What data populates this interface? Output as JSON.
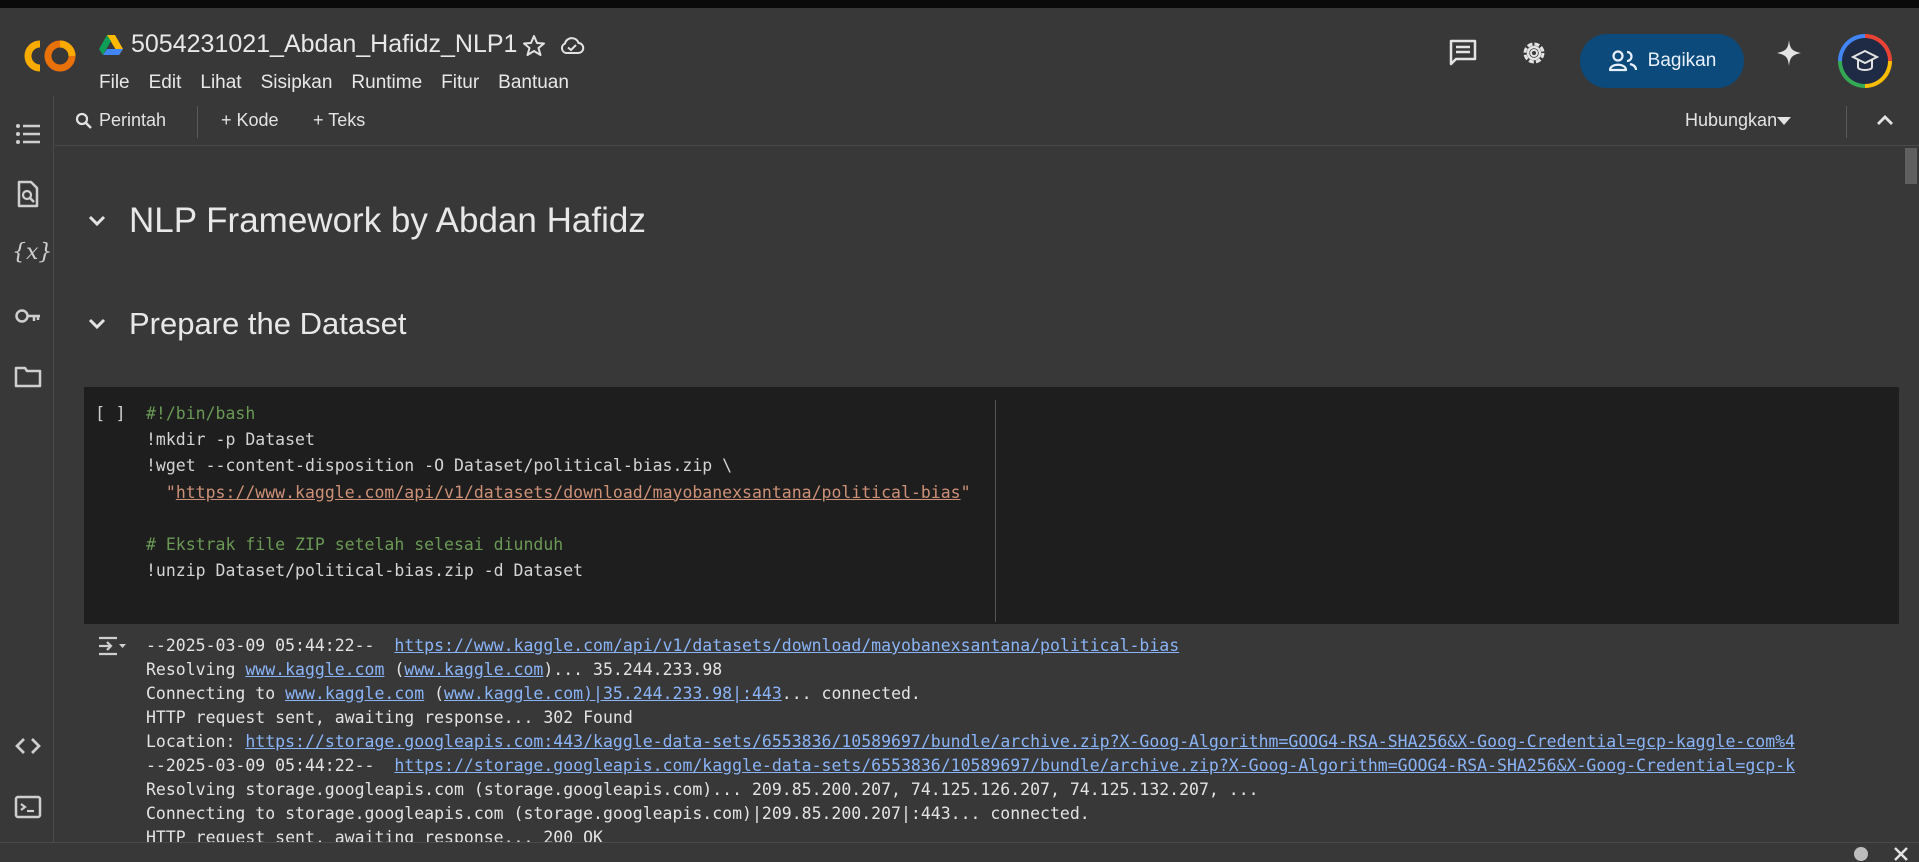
{
  "app": {
    "title": "5054231021_Abdan_Hafidz_NLP1",
    "menu": [
      "File",
      "Edit",
      "Lihat",
      "Sisipkan",
      "Runtime",
      "Fitur",
      "Bantuan"
    ],
    "share_label": "Bagikan"
  },
  "toolbar": {
    "command_label": "Perintah",
    "add_code_label": "+ Kode",
    "add_text_label": "+ Teks",
    "connect_label": "Hubungkan"
  },
  "notebook": {
    "heading1": "NLP Framework by Abdan Hafidz",
    "heading2": "Prepare the Dataset",
    "cell_brackets": "[ ]",
    "code": {
      "line1": "#!/bin/bash",
      "line2": "!mkdir -p Dataset",
      "line3": "!wget --content-disposition -O Dataset/political-bias.zip \\",
      "line4_q1": "  \"",
      "line4_url": "https://www.kaggle.com/api/v1/datasets/download/mayobanexsantana/political-bias",
      "line4_q2": "\"",
      "line6": "# Ekstrak file ZIP setelah selesai diunduh",
      "line7": "!unzip Dataset/political-bias.zip -d Dataset"
    },
    "output": {
      "l1_prefix": "--2025-03-09 05:44:22--  ",
      "l1_link": "https://www.kaggle.com/api/v1/datasets/download/mayobanexsantana/political-bias",
      "l2_a": "Resolving ",
      "l2_link1": "www.kaggle.com",
      "l2_b": " (",
      "l2_link2": "www.kaggle.com",
      "l2_c": ")... 35.244.233.98",
      "l3_a": "Connecting to ",
      "l3_link1": "www.kaggle.com",
      "l3_b": " (",
      "l3_link2": "www.kaggle.com)|35.244.233.98|:443",
      "l3_c": "... connected.",
      "l4": "HTTP request sent, awaiting response... 302 Found",
      "l5_a": "Location: ",
      "l5_link": "https://storage.googleapis.com:443/kaggle-data-sets/6553836/10589697/bundle/archive.zip?X-Goog-Algorithm=GOOG4-RSA-SHA256&X-Goog-Credential=gcp-kaggle-com%4",
      "l6_prefix": "--2025-03-09 05:44:22--  ",
      "l6_link": "https://storage.googleapis.com/kaggle-data-sets/6553836/10589697/bundle/archive.zip?X-Goog-Algorithm=GOOG4-RSA-SHA256&X-Goog-Credential=gcp-k",
      "l7": "Resolving storage.googleapis.com (storage.googleapis.com)... 209.85.200.207, 74.125.126.207, 74.125.132.207, ...",
      "l8": "Connecting to storage.googleapis.com (storage.googleapis.com)|209.85.200.207|:443... connected.",
      "l9": "HTTP request sent, awaiting response... 200 OK"
    }
  },
  "colors": {
    "accent": "#0b4a7b",
    "link": "#8ab4f8",
    "comment": "#6a9955",
    "string": "#ce9178"
  }
}
